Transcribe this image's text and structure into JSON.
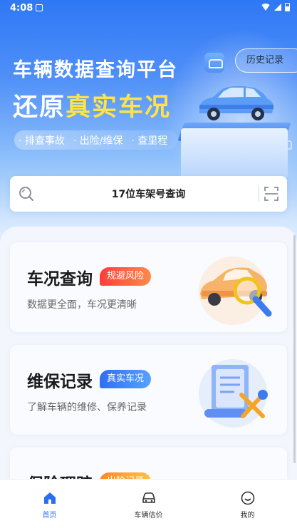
{
  "status_bar": {
    "time": "4:08"
  },
  "hero": {
    "title_line1": "车辆数据查询平台",
    "title_line2_prefix": "还原",
    "title_line2_highlight": "真实车况",
    "features": [
      "· 排查事故",
      "· 出险/维保",
      "· 查里程"
    ],
    "history_button": "历史记录",
    "colors": {
      "highlight": "#ffe34a",
      "brand": "#2c6df5"
    }
  },
  "search": {
    "placeholder": "17位车架号查询"
  },
  "cards": [
    {
      "title": "车况查询",
      "badge": "规避风险",
      "subtitle": "数据更全面，车况更清晰",
      "badge_color": "#ff3d3d"
    },
    {
      "title": "维保记录",
      "badge": "真实车况",
      "subtitle": "了解车辆的维修、保养记录",
      "badge_color": "#2f6ff3"
    },
    {
      "title": "保险理赔",
      "badge": "出险记录",
      "subtitle": "",
      "badge_color": "#ff8a24"
    }
  ],
  "tabbar": {
    "items": [
      {
        "label": "首页",
        "icon": "home-icon",
        "active": true
      },
      {
        "label": "车辆估价",
        "icon": "car-icon",
        "active": false
      },
      {
        "label": "我的",
        "icon": "smile-icon",
        "active": false
      }
    ]
  }
}
